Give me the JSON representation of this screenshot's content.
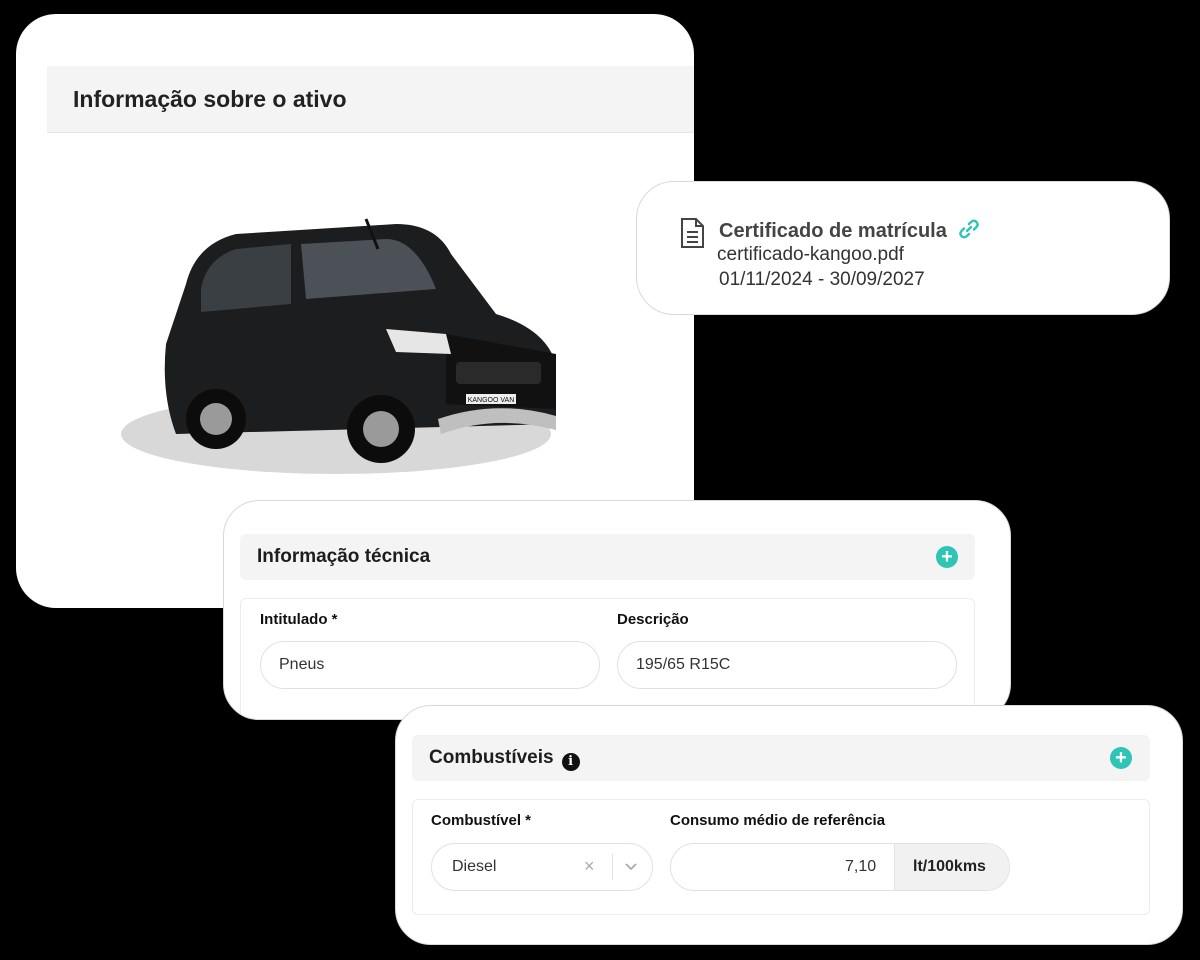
{
  "asset": {
    "title": "Informação sobre o ativo",
    "image_alt": "KANGOO VAN"
  },
  "certificate": {
    "title": "Certificado de matrícula",
    "file": "certificado-kangoo.pdf",
    "dates": "01/11/2024 - 30/09/2027",
    "doc_icon": "document-icon",
    "link_icon": "link-icon"
  },
  "technical": {
    "title": "Informação técnica",
    "field1_label": "Intitulado *",
    "field1_value": "Pneus",
    "field2_label": "Descrição",
    "field2_value": "195/65 R15C",
    "add_icon": "plus-icon"
  },
  "fuel": {
    "title": "Combustíveis",
    "fuel_label": "Combustível *",
    "fuel_value": "Diesel",
    "consumption_label": "Consumo médio de referência",
    "consumption_value": "7,10",
    "unit": "lt/100kms",
    "info_icon": "info-icon",
    "add_icon": "plus-icon"
  },
  "colors": {
    "accent": "#2ec4b6",
    "background": "#000000"
  }
}
